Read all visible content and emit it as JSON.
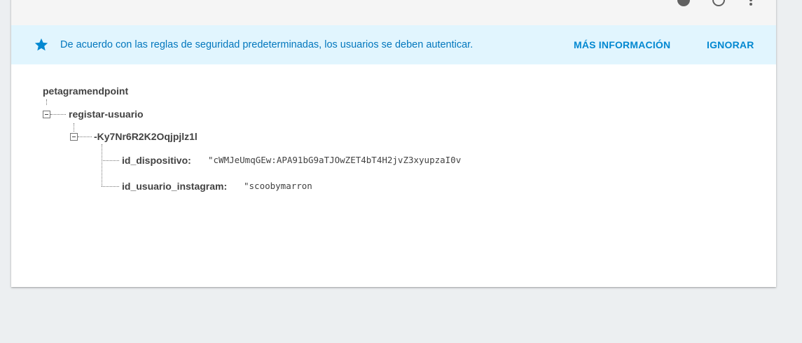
{
  "toolbar": {
    "url_fragment": "",
    "icons": [
      "help-icon",
      "history-icon",
      "more-vert-icon"
    ]
  },
  "banner": {
    "icon": "star-icon",
    "message": "De acuerdo con las reglas de seguridad predeterminadas, los usuarios se deben autenticar.",
    "learn_more_label": "MÁS INFORMACIÓN",
    "dismiss_label": "IGNORAR"
  },
  "colors": {
    "banner_bg": "#e1f5fe",
    "banner_text": "#0277bd",
    "banner_button": "#0288d1",
    "page_bg": "#eceff1"
  },
  "tree": {
    "root": "petagramendpoint",
    "child": "registar-usuario",
    "grandchild": "-Ky7Nr6R2K2Oqjpjlz1l",
    "fields": [
      {
        "key": "id_dispositivo:",
        "value": "\"cWMJeUmqGEw:APA91bG9aTJOwZET4bT4H2jvZ3xyupzaI0v"
      },
      {
        "key": "id_usuario_instagram:",
        "value": "\"scoobymarron"
      }
    ]
  }
}
